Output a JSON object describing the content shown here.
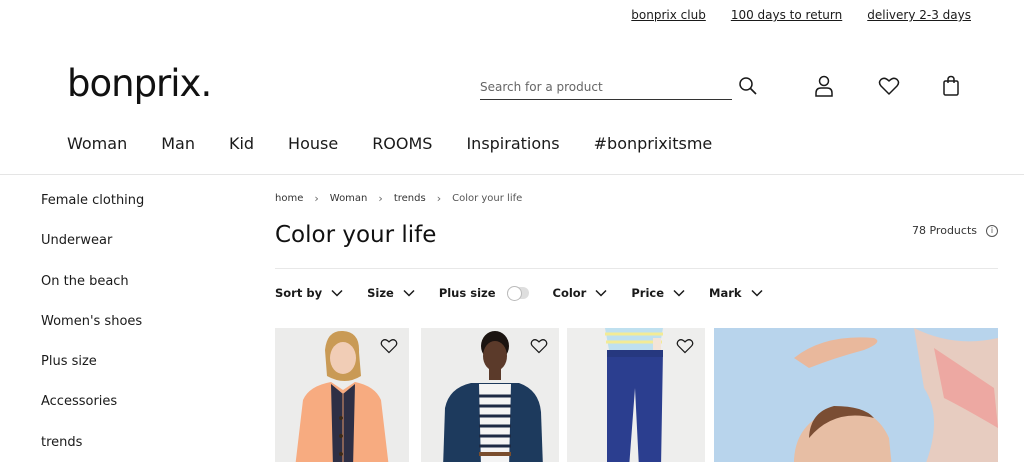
{
  "service_links": [
    "bonprix club",
    "100 days to return",
    "delivery 2-3 days"
  ],
  "logo": "bonprix.",
  "search": {
    "placeholder": "Search for a product"
  },
  "header_icons": [
    "search-icon",
    "user-icon",
    "heart-icon",
    "bag-icon"
  ],
  "main_nav": [
    "Woman",
    "Man",
    "Kid",
    "House",
    "ROOMS",
    "Inspirations",
    "#bonprixitsme"
  ],
  "sidebar": [
    "Female clothing",
    "Underwear",
    "On the beach",
    "Women's shoes",
    "Plus size",
    "Accessories",
    "trends"
  ],
  "breadcrumb": [
    "home",
    "Woman",
    "trends",
    "Color your life"
  ],
  "page_title": "Color your life",
  "product_count": "78 Products",
  "filters": {
    "sort_by": "Sort by",
    "size": "Size",
    "plus_size": "Plus size",
    "color": "Color",
    "price": "Price",
    "mark": "Mark"
  },
  "plus_size_toggle": false,
  "colors": {
    "text": "#1a1a1a",
    "divider": "#e5e5e5",
    "toggle": "#dedede"
  }
}
